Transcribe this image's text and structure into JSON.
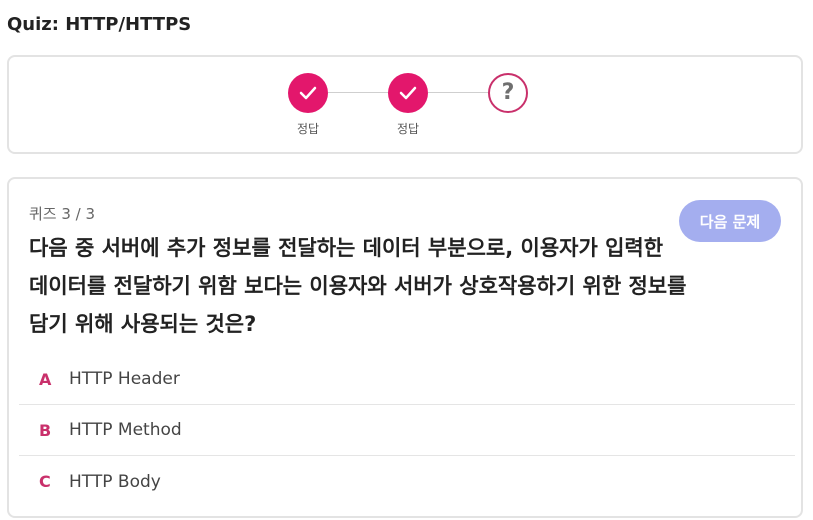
{
  "page": {
    "title": "Quiz: HTTP/HTTPS"
  },
  "progress": {
    "steps": [
      {
        "status": "correct",
        "icon": "check-icon",
        "label": "정답"
      },
      {
        "status": "correct",
        "icon": "check-icon",
        "label": "정답"
      },
      {
        "status": "pending",
        "icon": "question-mark-icon",
        "symbol": "?",
        "label": ""
      }
    ]
  },
  "quiz": {
    "counter": "퀴즈 3 / 3",
    "next_button_label": "다음 문제",
    "question": "다음 중 서버에 추가 정보를 전달하는 데이터 부분으로, 이용자가 입력한 데이터를 전달하기 위함 보다는 이용자와 서버가 상호작용하기 위한 정보를 담기 위해 사용되는 것은?",
    "options": [
      {
        "letter": "A",
        "text": "HTTP Header"
      },
      {
        "letter": "B",
        "text": "HTTP Method"
      },
      {
        "letter": "C",
        "text": "HTTP Body"
      }
    ]
  },
  "colors": {
    "accent": "#e3176c",
    "option_letter": "#c9306b",
    "next_button": "#a4aeef",
    "border": "#e3e3e3"
  }
}
